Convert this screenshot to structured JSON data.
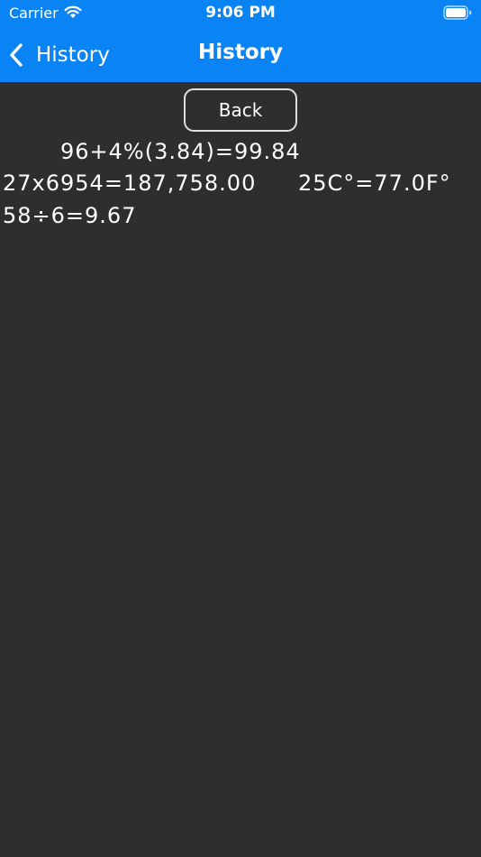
{
  "status_bar": {
    "carrier": "Carrier",
    "time": "9:06 PM",
    "icons": [
      "wifi-icon",
      "battery-icon"
    ]
  },
  "nav": {
    "back_label": "History",
    "title": "History",
    "back_icon": "chevron-left-icon",
    "background_color": "#0a84f5"
  },
  "content": {
    "back_button_label": "Back",
    "background_color": "#2e2e2e",
    "history": [
      "96+4%(3.84)=99.84",
      "27x6954=187,758.00",
      "25C°=77.0F°",
      "58÷6=9.67"
    ]
  }
}
